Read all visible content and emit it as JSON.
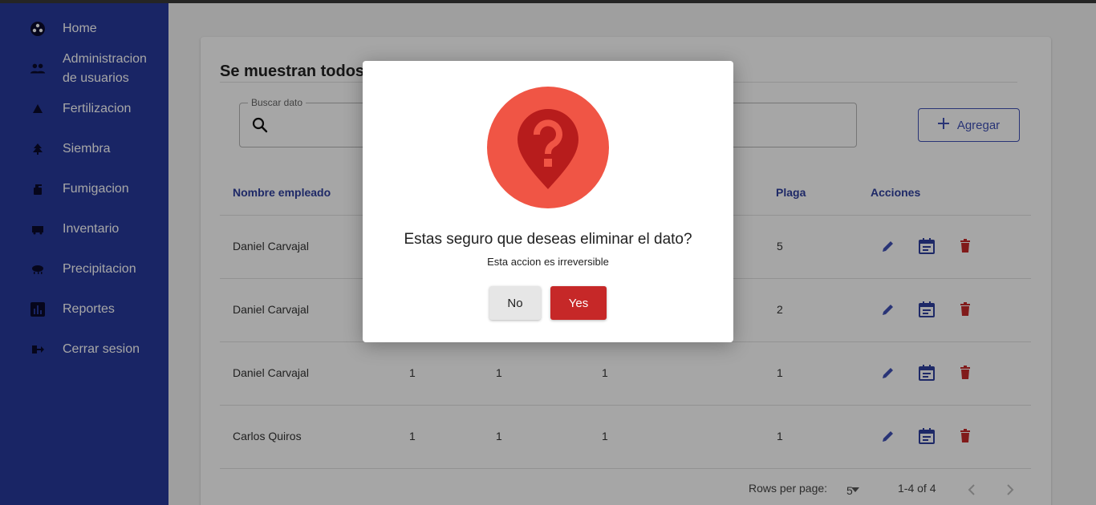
{
  "sidebar": {
    "items": [
      {
        "label": "Home",
        "icon": "home-icon"
      },
      {
        "label": "Administracion de usuarios",
        "line1": "Administracion",
        "line2": "de usuarios",
        "icon": "users-icon"
      },
      {
        "label": "Fertilizacion",
        "icon": "fertilizer-icon"
      },
      {
        "label": "Siembra",
        "icon": "tree-icon"
      },
      {
        "label": "Fumigacion",
        "icon": "sprayer-icon"
      },
      {
        "label": "Inventario",
        "icon": "inventory-icon"
      },
      {
        "label": "Precipitacion",
        "icon": "rain-icon"
      },
      {
        "label": "Reportes",
        "icon": "bar-chart-icon"
      },
      {
        "label": "Cerrar sesion",
        "icon": "logout-icon"
      }
    ]
  },
  "main": {
    "title": "Se muestran todos l",
    "search": {
      "legend": "Buscar dato",
      "value": "",
      "placeholder": ""
    },
    "add_label": "Agregar",
    "table": {
      "columns": [
        "Nombre empleado",
        "Plaga",
        "Acciones"
      ],
      "rows": [
        {
          "name": "Daniel Carvajal",
          "c1": "",
          "c2": "",
          "c3": "",
          "plaga": "5"
        },
        {
          "name": "Daniel Carvajal",
          "c1": "",
          "c2": "",
          "c3": "",
          "plaga": "2"
        },
        {
          "name": "Daniel Carvajal",
          "c1": "1",
          "c2": "1",
          "c3": "1",
          "plaga": "1"
        },
        {
          "name": "Carlos Quiros",
          "c1": "1",
          "c2": "1",
          "c3": "1",
          "plaga": "1"
        }
      ]
    },
    "pager": {
      "rows_per_page_label": "Rows per page:",
      "rows_per_page": "5",
      "range": "1-4 of 4"
    }
  },
  "dialog": {
    "title": "Estas seguro que deseas eliminar el dato?",
    "subtitle": "Esta accion es irreversible",
    "no_label": "No",
    "yes_label": "Yes",
    "icon": "question-pin-icon"
  },
  "colors": {
    "sidebar": "#27399c",
    "accent": "#3f51b5",
    "danger": "#c62828",
    "icon_circle": "#f05545"
  }
}
